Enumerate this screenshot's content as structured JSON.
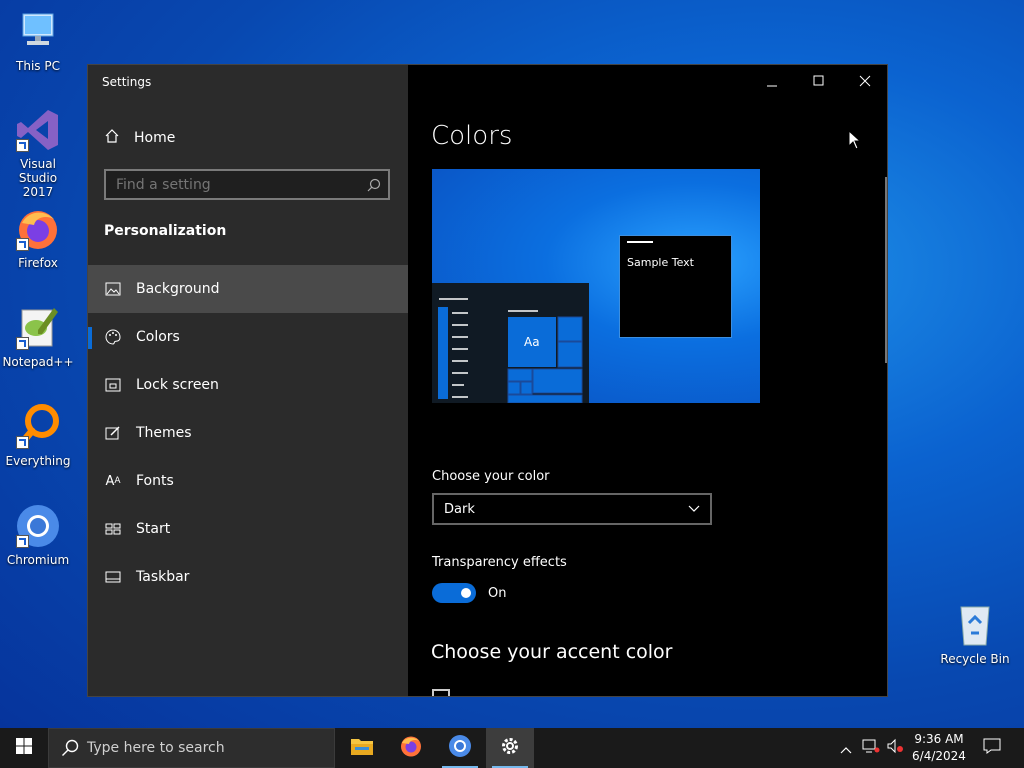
{
  "desktop": {
    "icons": [
      {
        "label": "This PC"
      },
      {
        "label": "Visual Studio 2017"
      },
      {
        "label": "Firefox"
      },
      {
        "label": "Notepad++"
      },
      {
        "label": "Everything"
      },
      {
        "label": "Chromium"
      },
      {
        "label": "Recycle Bin"
      }
    ]
  },
  "window": {
    "title": "Settings",
    "home_label": "Home",
    "search_placeholder": "Find a setting",
    "section": "Personalization",
    "nav": [
      {
        "label": "Background",
        "icon": "picture-icon"
      },
      {
        "label": "Colors",
        "icon": "palette-icon"
      },
      {
        "label": "Lock screen",
        "icon": "lock-screen-icon"
      },
      {
        "label": "Themes",
        "icon": "brush-icon"
      },
      {
        "label": "Fonts",
        "icon": "fonts-icon"
      },
      {
        "label": "Start",
        "icon": "start-icon"
      },
      {
        "label": "Taskbar",
        "icon": "taskbar-icon"
      }
    ],
    "active_nav": "Colors",
    "hovered_nav": "Background"
  },
  "main": {
    "title": "Colors",
    "preview": {
      "sample_text": "Sample Text",
      "tile_text": "Aa"
    },
    "choose_color_label": "Choose your color",
    "choose_color_value": "Dark",
    "transparency_label": "Transparency effects",
    "transparency_state": "On",
    "accent_heading": "Choose your accent color",
    "accent_color": "#0a6cd8"
  },
  "taskbar": {
    "search_placeholder": "Type here to search",
    "apps": [
      "file-explorer-icon",
      "firefox-icon",
      "chromium-icon",
      "settings-icon"
    ],
    "time": "9:36 AM",
    "date": "6/4/2024"
  }
}
